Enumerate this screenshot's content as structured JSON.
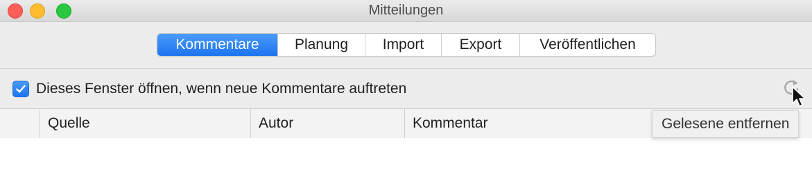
{
  "window": {
    "title": "Mitteilungen",
    "controls": {
      "close_color": "#fe5f57",
      "minimize_color": "#febc2e",
      "maximize_color": "#28c840"
    }
  },
  "tabs": [
    {
      "label": "Kommentare",
      "active": true
    },
    {
      "label": "Planung",
      "active": false
    },
    {
      "label": "Import",
      "active": false
    },
    {
      "label": "Export",
      "active": false
    },
    {
      "label": "Veröffentlichen",
      "active": false
    }
  ],
  "options": {
    "open_window_checkbox": {
      "label": "Dieses Fenster öffnen, wenn neue Kommentare auftreten",
      "checked": true
    }
  },
  "toolbar": {
    "refresh_icon": "refresh-icon"
  },
  "table": {
    "columns": [
      "",
      "Quelle",
      "Autor",
      "Kommentar"
    ],
    "rows": []
  },
  "tooltip": {
    "text": "Gelesene entfernen"
  },
  "colors": {
    "accent": "#1d74f0",
    "background": "#ececec"
  }
}
